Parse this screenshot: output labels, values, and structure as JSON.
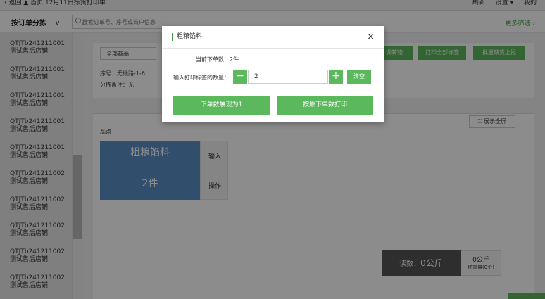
{
  "topbar": {
    "left_text": "‹ 返回  ▲ 首页  12月11日拣货打印单",
    "right_items": [
      "刷新",
      "设置 ▾",
      "我的"
    ]
  },
  "filterbar": {
    "sort_label": "按订单分拣",
    "search_placeholder": "搜索订单号、序号或商户信息",
    "more_filter": "更多筛选 ›"
  },
  "sidebar": {
    "items": [
      {
        "line1": "QTJTb241211001",
        "line2": "测试售后店铺"
      },
      {
        "line1": "QTJTb241211001",
        "line2": "测试售后店铺"
      },
      {
        "line1": "QTJTb241211001",
        "line2": "测试售后店铺"
      },
      {
        "line1": "QTJTb241211001",
        "line2": "测试售后店铺"
      },
      {
        "line1": "QTJTb241211001",
        "line2": "测试售后店铺"
      },
      {
        "line1": "QTJTb241211002",
        "line2": "测试售后店铺"
      },
      {
        "line1": "QTJTb241211002",
        "line2": "测试售后店铺"
      },
      {
        "line1": "QTJTb241211002",
        "line2": "测试售后店铺"
      },
      {
        "line1": "QTJTb241211002",
        "line2": "测试售后店铺"
      },
      {
        "line1": "QTJTb241211002",
        "line2": "测试售后店铺"
      }
    ]
  },
  "main": {
    "goods_select": "全部商品",
    "actions": [
      "调转物",
      "打印全部标签",
      "批量缺货上报"
    ],
    "info_seq": "序号：无线路-1-6",
    "info_note": "分拣备注：无",
    "fullscreen": "展示全屏",
    "location": "品点",
    "product": {
      "name": "粗粮馅料",
      "qty": "2件"
    },
    "card_actions": [
      "输入",
      "操作"
    ],
    "weight": {
      "label": "读数：",
      "value": "0公斤",
      "side_value": "0公斤",
      "side_label": "称重量(0个)"
    }
  },
  "modal": {
    "title": "粗粮馅料",
    "close": "×",
    "current_label": "当前下单数：2件",
    "input_label": "输入打印标签的数量：",
    "minus": "−",
    "plus": "+",
    "quantity": "2",
    "clear": "清空",
    "btn_reset": "下单数展现为1",
    "btn_print": "按原下单数打印"
  }
}
